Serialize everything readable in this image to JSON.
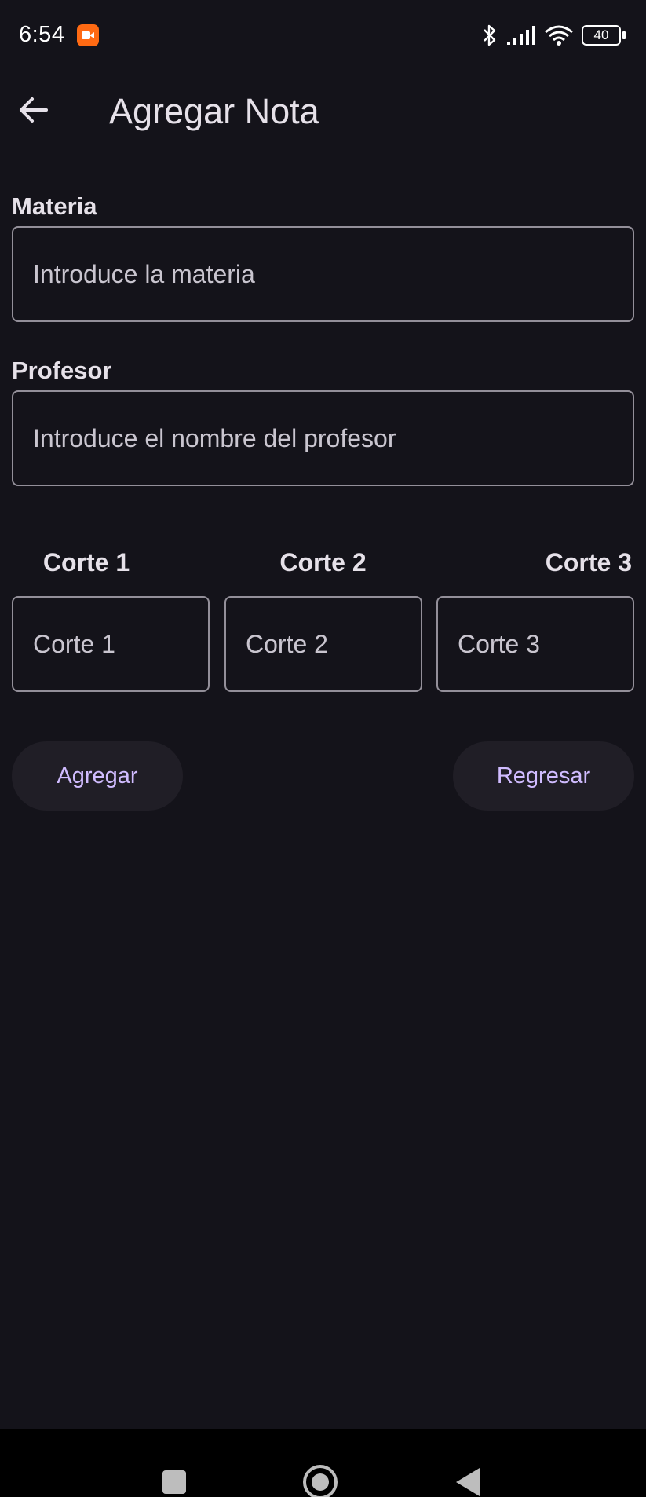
{
  "status_bar": {
    "time": "6:54",
    "battery": "40",
    "icons": [
      "screen-record-icon",
      "bluetooth-icon",
      "signal-icon",
      "wifi-icon",
      "battery-icon"
    ]
  },
  "app_bar": {
    "title": "Agregar Nota",
    "back_icon": "arrow-back-icon"
  },
  "form": {
    "materia": {
      "label": "Materia",
      "placeholder": "Introduce la materia",
      "value": ""
    },
    "profesor": {
      "label": "Profesor",
      "placeholder": "Introduce el nombre del profesor",
      "value": ""
    },
    "cortes": [
      {
        "label": "Corte 1",
        "placeholder": "Corte 1",
        "value": ""
      },
      {
        "label": "Corte 2",
        "placeholder": "Corte 2",
        "value": ""
      },
      {
        "label": "Corte 3",
        "placeholder": "Corte 3",
        "value": ""
      }
    ]
  },
  "actions": {
    "add_label": "Agregar",
    "back_label": "Regresar"
  },
  "nav_bar": {
    "icons": [
      "recents-icon",
      "home-icon",
      "back-triangle-icon"
    ]
  },
  "colors": {
    "background": "#14131a",
    "accent": "#d0bcff",
    "outline": "#938f99",
    "button_bg": "#201e26",
    "record_orange": "#ff6a13"
  }
}
